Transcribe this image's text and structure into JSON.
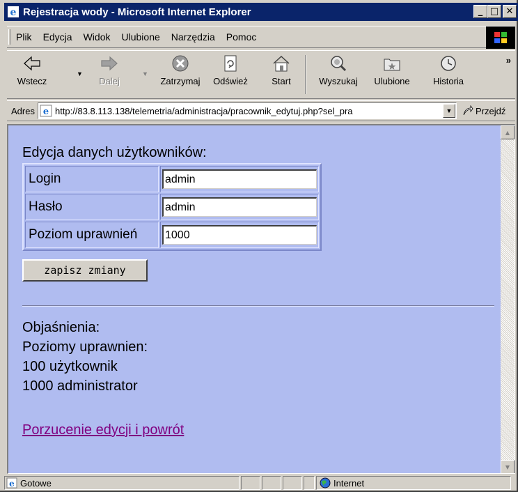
{
  "window": {
    "title": "Rejestracja wody - Microsoft Internet Explorer",
    "minimize_label": "_",
    "maximize_label": "□",
    "close_label": "✕"
  },
  "menu": {
    "items": [
      {
        "label": "Plik"
      },
      {
        "label": "Edycja"
      },
      {
        "label": "Widok"
      },
      {
        "label": "Ulubione"
      },
      {
        "label": "Narzędzia"
      },
      {
        "label": "Pomoc"
      }
    ]
  },
  "toolbar": {
    "back": "Wstecz",
    "forward": "Dalej",
    "stop": "Zatrzymaj",
    "refresh": "Odśwież",
    "home": "Start",
    "search": "Wyszukaj",
    "favorites": "Ulubione",
    "history": "Historia",
    "more": "»"
  },
  "address": {
    "label": "Adres",
    "url": "http://83.8.113.138/telemetria/administracja/pracownik_edytuj.php?sel_pra",
    "go": "Przejdź"
  },
  "page": {
    "heading": "Edycja danych użytkowników:",
    "fields": {
      "login_label": "Login",
      "login_value": "admin",
      "password_label": "Hasło",
      "password_value": "admin",
      "level_label": "Poziom uprawnień",
      "level_value": "1000"
    },
    "save_button": "zapisz zmiany",
    "notes": {
      "title": "Objaśnienia:",
      "levels_title": "Poziomy uprawnien:",
      "level_user": "100 użytkownik",
      "level_admin": "1000 administrator"
    },
    "back_link": "Porzucenie edycji i powrót"
  },
  "status": {
    "text": "Gotowe",
    "zone": "Internet"
  },
  "colors": {
    "titlebar": "#0a246a",
    "page_background": "#b0bcf0",
    "visited_link": "#800080",
    "chrome": "#d4d0c8"
  }
}
